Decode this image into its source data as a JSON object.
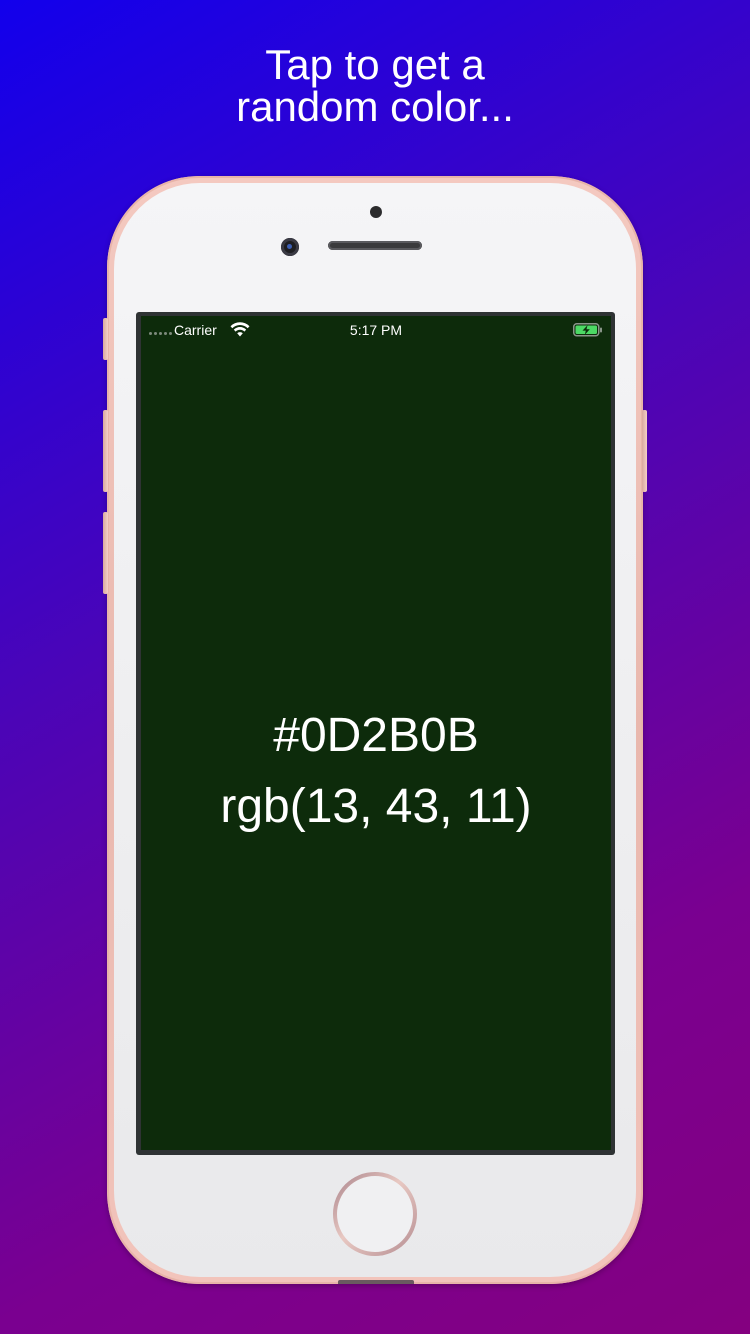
{
  "headline": {
    "line1": "Tap to get a",
    "line2": "random color..."
  },
  "status_bar": {
    "carrier": "Carrier",
    "time": "5:17 PM",
    "signal_icon": "signal-dots-icon",
    "wifi_icon": "wifi-icon",
    "battery_icon": "battery-charging-icon"
  },
  "color": {
    "hex": "#0D2B0B",
    "rgb": "rgb(13, 43, 11)",
    "swatch": "#0d2b0b"
  },
  "device": {
    "model": "phone",
    "finish": "rose-gold"
  }
}
